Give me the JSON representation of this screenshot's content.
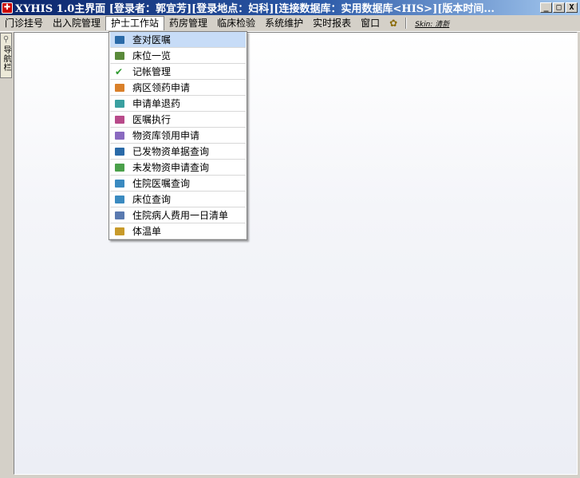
{
  "window": {
    "title": "XYHIS 1.0主界面 [登录者：郭宜芳][登录地点：妇科][连接数据库：实用数据库<HIS>][版本时间...",
    "controls": [
      "_",
      "□",
      "X"
    ]
  },
  "menubar": {
    "items": [
      "门诊挂号",
      "出入院管理",
      "护士工作站",
      "药房管理",
      "临床检验",
      "系统维护",
      "实时报表",
      "窗口"
    ],
    "active_index": 2,
    "skin_label": "Skin: 清新"
  },
  "navtab": {
    "label": "导航栏"
  },
  "dropdown": {
    "items": [
      {
        "label": "查对医嘱",
        "icon": "monitor-icon",
        "color": "#2a6aa8"
      },
      {
        "label": "床位一览",
        "icon": "bed-icon",
        "color": "#5a8a3a"
      },
      {
        "label": "记帐管理",
        "icon": "checkmark-icon",
        "color": "#2e9a2e"
      },
      {
        "label": "病区领药申请",
        "icon": "medicine-bag-icon",
        "color": "#d9802a"
      },
      {
        "label": "申请单退药",
        "icon": "return-medicine-icon",
        "color": "#3aa0a0"
      },
      {
        "label": "医嘱执行",
        "icon": "execute-icon",
        "color": "#b84a8a"
      },
      {
        "label": "物资库领用申请",
        "icon": "supplies-icon",
        "color": "#8a6ac0"
      },
      {
        "label": "已发物资单据查询",
        "icon": "issued-doc-icon",
        "color": "#2a6aa8"
      },
      {
        "label": "未发物资申请查询",
        "icon": "pending-doc-icon",
        "color": "#4aa04a"
      },
      {
        "label": "住院医嘱查询",
        "icon": "inpatient-orders-icon",
        "color": "#3a8ac0"
      },
      {
        "label": "床位查询",
        "icon": "bed-search-icon",
        "color": "#3a8ac0"
      },
      {
        "label": "住院病人费用一日清单",
        "icon": "daily-bill-icon",
        "color": "#5a7ab0"
      },
      {
        "label": "体温单",
        "icon": "temperature-chart-icon",
        "color": "#c89a2a"
      }
    ],
    "highlight_index": 0
  }
}
